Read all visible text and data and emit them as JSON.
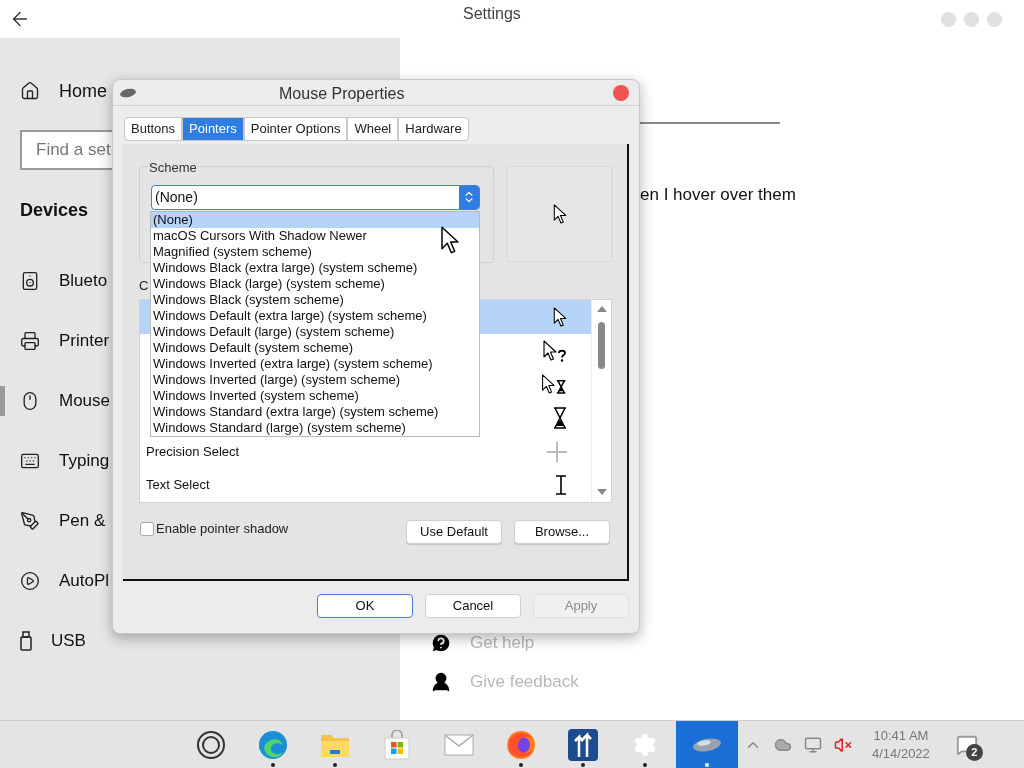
{
  "settings_window": {
    "title": "Settings",
    "sidebar": {
      "home": "Home",
      "search": {
        "placeholder": "Find a set"
      },
      "section": "Devices",
      "items": [
        {
          "label": "Blueto",
          "kind": "bluetooth",
          "selected": false
        },
        {
          "label": "Printer",
          "kind": "printer",
          "selected": false
        },
        {
          "label": "Mouse",
          "kind": "mouse",
          "selected": true
        },
        {
          "label": "Typing",
          "kind": "keyboard",
          "selected": false
        },
        {
          "label": "Pen &",
          "kind": "pen",
          "selected": false
        },
        {
          "label": "AutoPl",
          "kind": "autoplay",
          "selected": false
        },
        {
          "label": "USB",
          "kind": "usb",
          "selected": false
        }
      ]
    },
    "content": {
      "description": "en I hover over them",
      "links": [
        {
          "label": "Get help",
          "kind": "help"
        },
        {
          "label": "Give feedback",
          "kind": "feedback"
        }
      ]
    }
  },
  "dialog": {
    "title": "Mouse Properties",
    "tabs": [
      {
        "label": "Buttons",
        "selected": false
      },
      {
        "label": "Pointers",
        "selected": true
      },
      {
        "label": "Pointer Options",
        "selected": false
      },
      {
        "label": "Wheel",
        "selected": false
      },
      {
        "label": "Hardware",
        "selected": false
      }
    ],
    "scheme": {
      "label": "Scheme",
      "value": "(None)",
      "options": [
        {
          "label": "(None)",
          "selected": true
        },
        {
          "label": "macOS Cursors With Shadow Newer",
          "selected": false
        },
        {
          "label": "Magnified (system scheme)",
          "selected": false
        },
        {
          "label": "Windows Black (extra large) (system scheme)",
          "selected": false
        },
        {
          "label": "Windows Black (large) (system scheme)",
          "selected": false
        },
        {
          "label": "Windows Black (system scheme)",
          "selected": false
        },
        {
          "label": "Windows Default (extra large) (system scheme)",
          "selected": false
        },
        {
          "label": "Windows Default (large) (system scheme)",
          "selected": false
        },
        {
          "label": "Windows Default (system scheme)",
          "selected": false
        },
        {
          "label": "Windows Inverted (extra large) (system scheme)",
          "selected": false
        },
        {
          "label": "Windows Inverted (large) (system scheme)",
          "selected": false
        },
        {
          "label": "Windows Inverted (system scheme)",
          "selected": false
        },
        {
          "label": "Windows Standard (extra large) (system scheme)",
          "selected": false
        },
        {
          "label": "Windows Standard (large) (system scheme)",
          "selected": false
        }
      ]
    },
    "customize_label": "C",
    "pointers": [
      {
        "kind": "normal",
        "selected": true
      },
      {
        "kind": "help",
        "selected": false
      },
      {
        "kind": "working",
        "selected": false
      },
      {
        "kind": "busy",
        "selected": false
      },
      {
        "label": "Precision Select",
        "kind": "precision",
        "selected": false
      },
      {
        "label": "Text Select",
        "kind": "text",
        "selected": false
      }
    ],
    "pointer_shadow": {
      "label": "Enable pointer shadow",
      "checked": false
    },
    "buttons": [
      {
        "label": "Use Default"
      },
      {
        "label": "Browse..."
      }
    ],
    "footer_buttons": [
      {
        "label": "OK",
        "default": true,
        "disabled": false
      },
      {
        "label": "Cancel",
        "default": false,
        "disabled": false
      },
      {
        "label": "Apply",
        "default": false,
        "disabled": true
      }
    ]
  },
  "taskbar": {
    "apps": [
      {
        "kind": "ring",
        "running": false,
        "selected": false
      },
      {
        "kind": "browser",
        "running": true,
        "selected": false
      },
      {
        "kind": "folder",
        "running": true,
        "selected": false
      },
      {
        "kind": "store",
        "running": false,
        "selected": false
      },
      {
        "kind": "mail",
        "running": false,
        "selected": false
      },
      {
        "kind": "firefox",
        "running": true,
        "selected": false
      },
      {
        "kind": "arrows",
        "running": true,
        "selected": false
      },
      {
        "kind": "settings",
        "running": true,
        "selected": false
      },
      {
        "kind": "mouse",
        "running": true,
        "selected": true
      }
    ],
    "tray": {
      "time": "10:41 AM",
      "date": "4/14/2022",
      "notifications": "2"
    }
  }
}
